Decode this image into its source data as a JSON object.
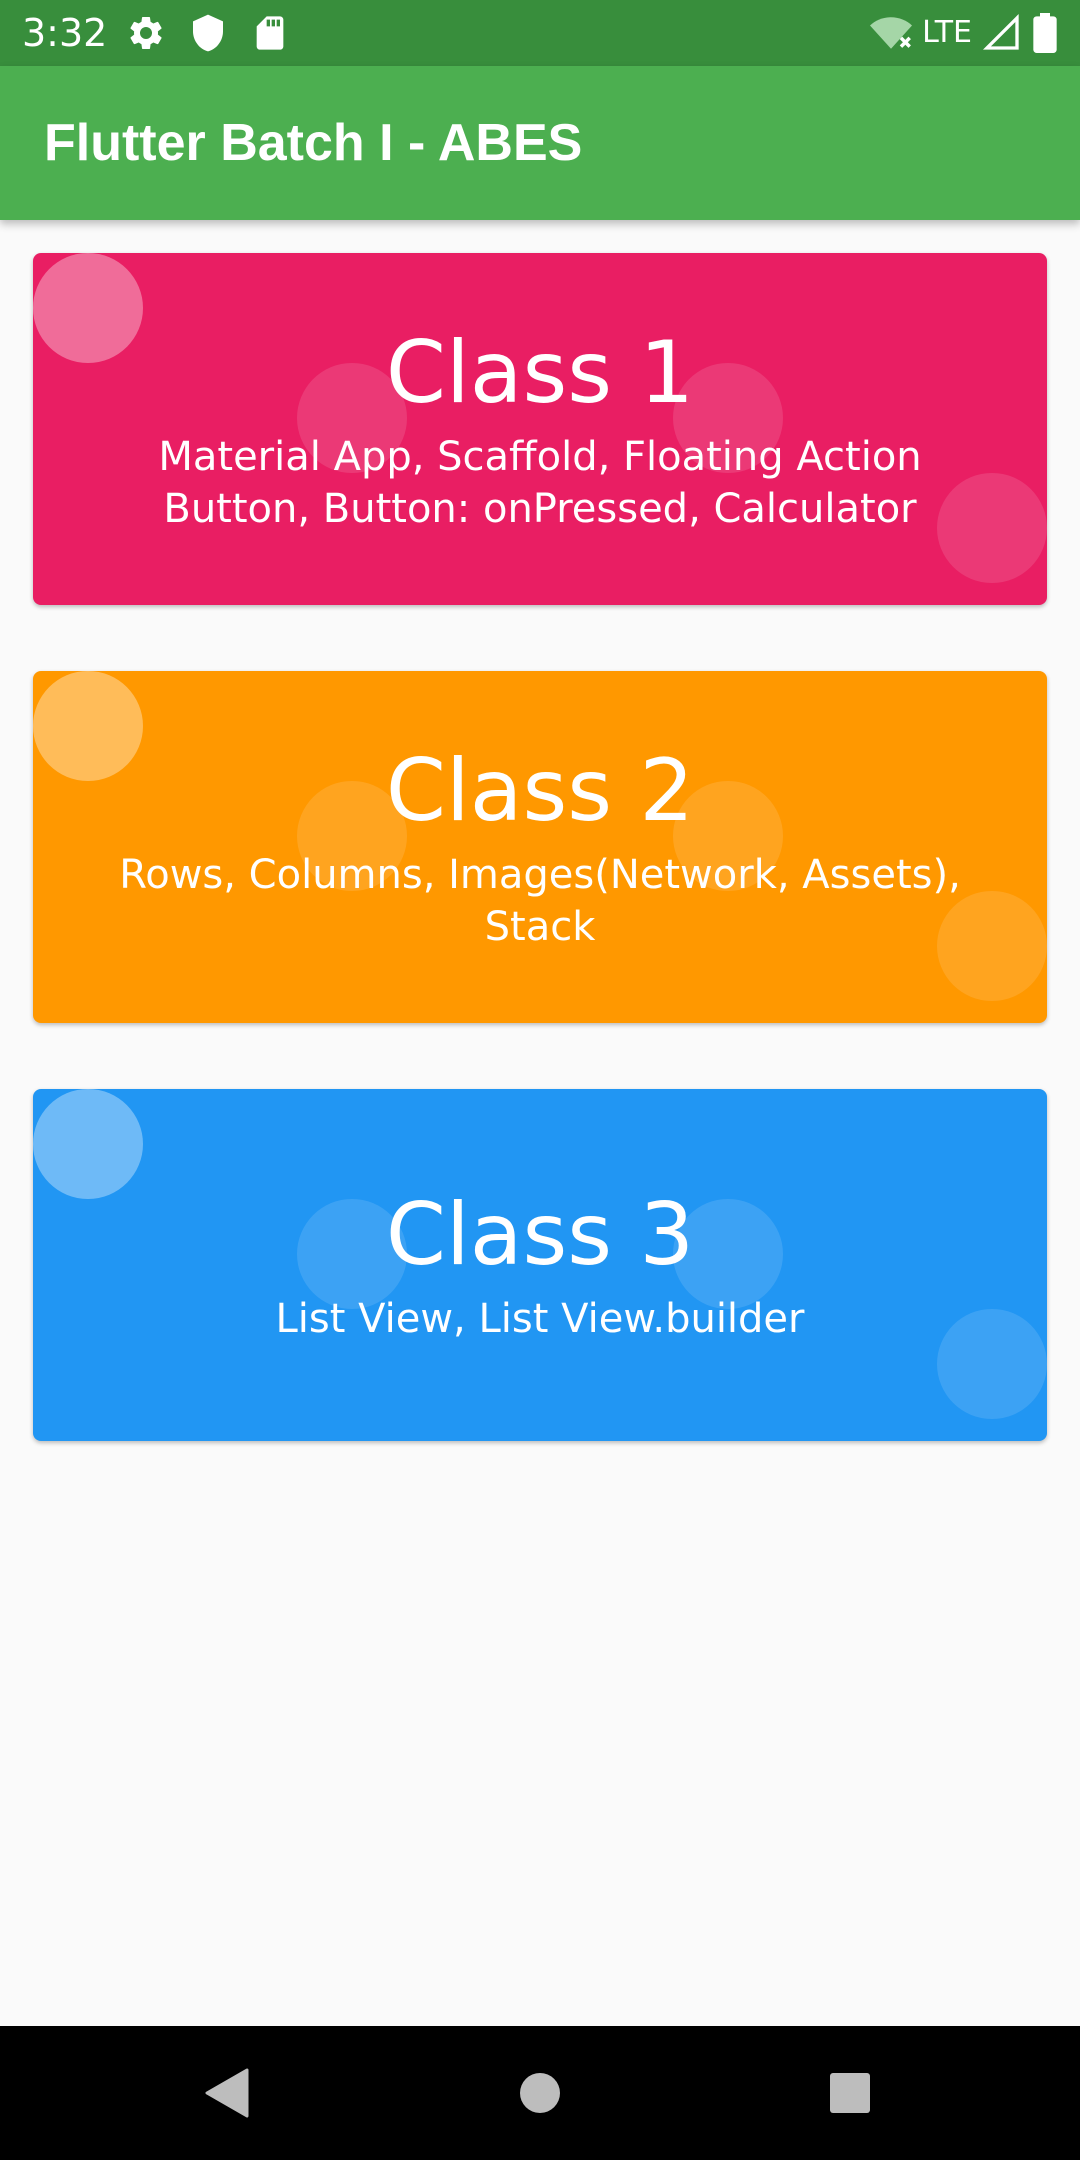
{
  "status_bar": {
    "time": "3:32",
    "network_label": "LTE",
    "icons": [
      "gear-icon",
      "shield-icon",
      "sd-card-icon",
      "wifi-off-icon",
      "signal-icon",
      "battery-icon"
    ]
  },
  "app_bar": {
    "title": "Flutter Batch I - ABES"
  },
  "cards": [
    {
      "title": "Class 1",
      "description": "Material App, Scaffold, Floating Action Button, Button: onPressed, Calculator",
      "color": "#e91e63"
    },
    {
      "title": "Class 2",
      "description": "Rows, Columns, Images(Network, Assets), Stack",
      "color": "#ff9800"
    },
    {
      "title": "Class 3",
      "description": "List View, List View.builder",
      "color": "#2196f3"
    }
  ],
  "navigation_bar": {
    "icons": [
      "back-icon",
      "home-icon",
      "recents-icon"
    ]
  },
  "theme": {
    "status_bar_color": "#388e3c",
    "app_bar_color": "#4caf50",
    "background_color": "#fafafa"
  }
}
